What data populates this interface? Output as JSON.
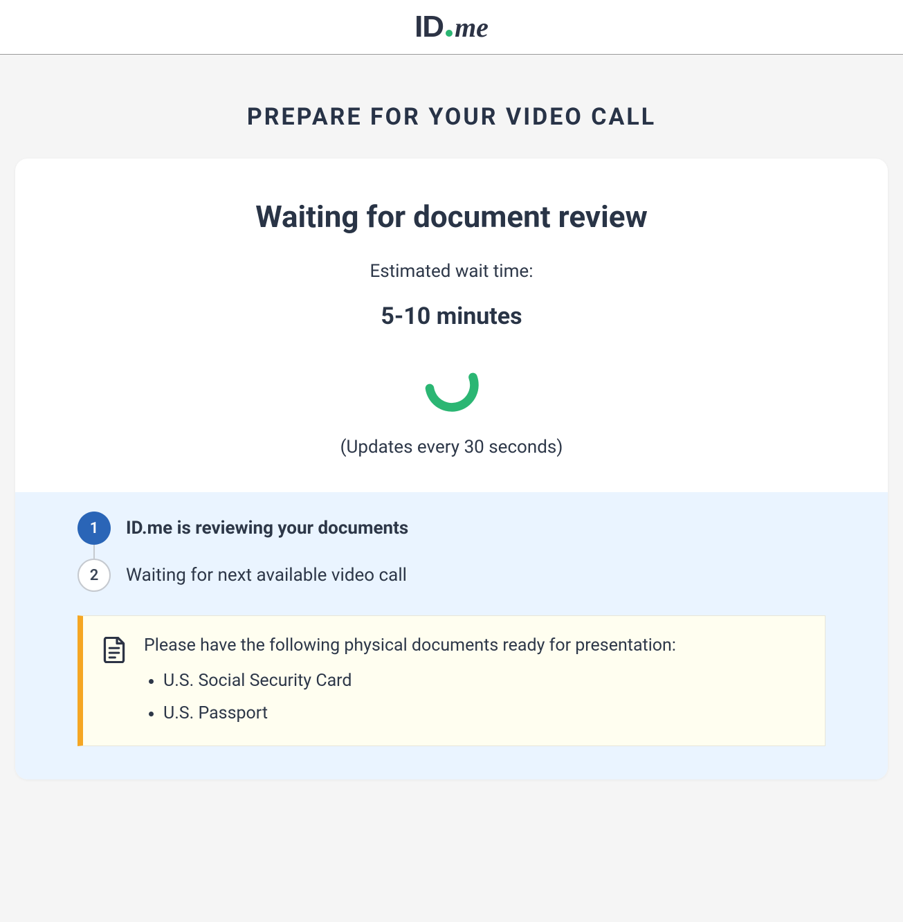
{
  "logo": {
    "id": "ID",
    "me": "me"
  },
  "page": {
    "title": "PREPARE FOR YOUR VIDEO CALL"
  },
  "card": {
    "heading": "Waiting for document review",
    "estimated_label": "Estimated wait time:",
    "estimated_value": "5-10 minutes",
    "update_note": "(Updates every 30 seconds)"
  },
  "steps": [
    {
      "num": "1",
      "label": "ID.me is reviewing your documents",
      "active": true
    },
    {
      "num": "2",
      "label": "Waiting for next available video call",
      "active": false
    }
  ],
  "notice": {
    "text": "Please have the following physical documents ready for presentation:",
    "items": [
      "U.S. Social Security Card",
      "U.S. Passport"
    ]
  },
  "colors": {
    "accent_blue": "#2a65b7",
    "accent_green": "#2bb673",
    "warn_orange": "#f5a623"
  }
}
